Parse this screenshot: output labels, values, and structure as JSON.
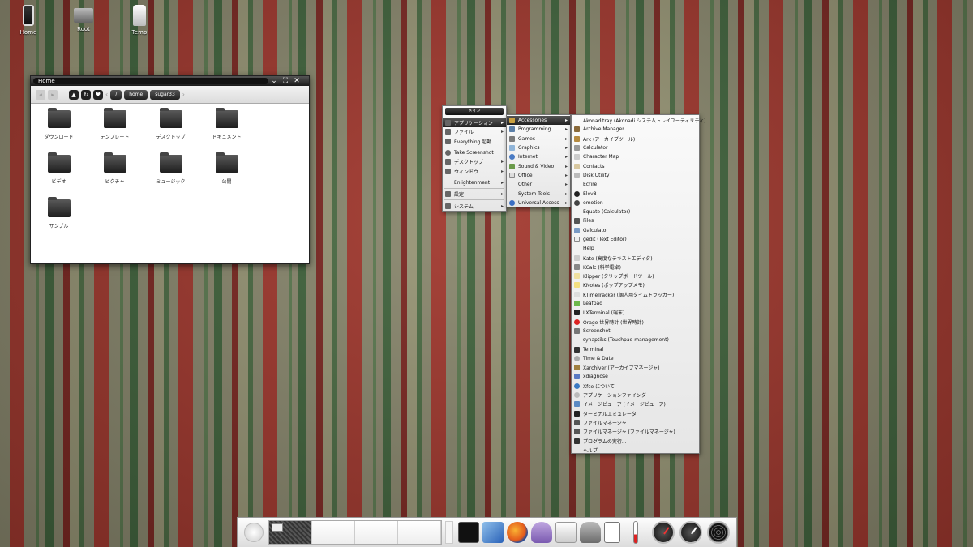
{
  "desktop_icons": [
    {
      "label": "Home",
      "icon": "trash-icon"
    },
    {
      "label": "Root",
      "icon": "laptop-icon"
    },
    {
      "label": "Temp",
      "icon": "drive-icon"
    }
  ],
  "file_manager": {
    "title": "Home",
    "breadcrumbs": [
      "/",
      "home",
      "sugar33"
    ],
    "folders": [
      "ダウンロード",
      "テンプレート",
      "デスクトップ",
      "ドキュメント",
      "ビデオ",
      "ピクチャ",
      "ミュージック",
      "公開",
      "サンプル"
    ]
  },
  "main_menu": {
    "title": "メイン",
    "items": [
      {
        "label": "アプリケーション",
        "submenu": true,
        "highlighted": true
      },
      {
        "label": "ファイル",
        "submenu": true
      },
      {
        "label": "Everything 起動",
        "submenu": false
      },
      {
        "separator": true
      },
      {
        "label": "Take Screenshot",
        "submenu": false
      },
      {
        "label": "デスクトップ",
        "submenu": true
      },
      {
        "label": "ウィンドウ",
        "submenu": true
      },
      {
        "separator": true
      },
      {
        "label": "Enlightenment",
        "submenu": true
      },
      {
        "separator": true
      },
      {
        "label": "設定",
        "submenu": true
      },
      {
        "separator": true
      },
      {
        "label": "システム",
        "submenu": true
      }
    ]
  },
  "category_menu": {
    "items": [
      {
        "label": "Accessories",
        "highlighted": true
      },
      {
        "label": "Programming"
      },
      {
        "label": "Games"
      },
      {
        "label": "Graphics"
      },
      {
        "label": "Internet"
      },
      {
        "label": "Sound & Video"
      },
      {
        "label": "Office"
      },
      {
        "label": "Other"
      },
      {
        "label": "System Tools"
      },
      {
        "label": "Universal Access"
      }
    ]
  },
  "accessories_menu": {
    "items": [
      "Akonaditray (Akonadi システムトレイユーティリティ)",
      "Archive Manager",
      "Ark (アーカイブツール)",
      "Calculator",
      "Character Map",
      "Contacts",
      "Disk Utility",
      "Ecrire",
      "Elev8",
      "emotion",
      "Equate (Calculator)",
      "Files",
      "Galculator",
      "gedit (Text Editor)",
      "Help",
      "Kate (高度なテキストエディタ)",
      "KCalc (科学電卓)",
      "Klipper (クリップボードツール)",
      "KNotes (ポップアップメモ)",
      "KTimeTracker (個人用タイムトラッカー)",
      "Leafpad",
      "LXTerminal (端末)",
      "Orage 世界時計 (世界時計)",
      "Screenshot",
      "synaptiks (Touchpad management)",
      "Terminal",
      "Time & Date",
      "Xarchiver (アーカイブマネージャ)",
      "xdiagnose",
      "Xfce について",
      "アプリケーションファインダ",
      "イメージビューア (イメージビューア)",
      "ターミナルエミュレータ",
      "ファイルマネージャ",
      "ファイルマネージャ (ファイルマネージャ)",
      "プログラムの実行...",
      "ヘルプ"
    ]
  },
  "dock": {
    "pages": 4,
    "apps": [
      "terminal-icon",
      "image-viewer-icon",
      "firefox-icon",
      "pidgin-icon",
      "chat-icon",
      "gimp-icon",
      "document-icon"
    ],
    "gauges": [
      "thermometer-icon",
      "cpu-gauge-icon",
      "clock-gauge-icon",
      "network-rings-icon"
    ]
  }
}
